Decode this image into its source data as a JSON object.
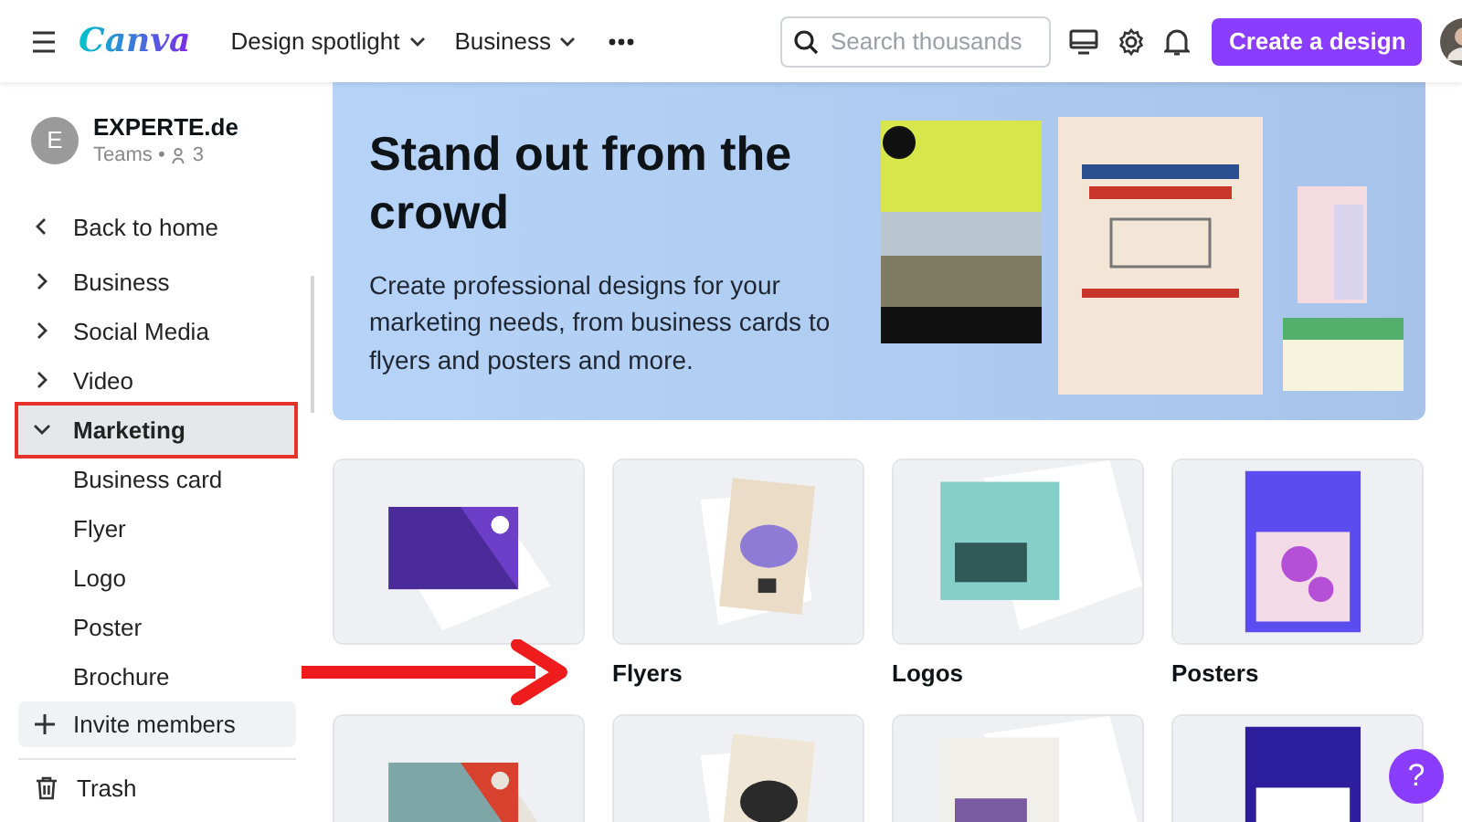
{
  "header": {
    "logo": "Canva",
    "nav": [
      {
        "label": "Design spotlight"
      },
      {
        "label": "Business"
      }
    ],
    "search": {
      "placeholder": "Search thousands"
    },
    "create_button": "Create a design"
  },
  "sidebar": {
    "team": {
      "initial": "E",
      "name": "EXPERTE.de",
      "plan": "Teams •",
      "members": "3"
    },
    "items": [
      {
        "kind": "back",
        "label": "Back to home",
        "selected": false
      },
      {
        "kind": "folder",
        "label": "Business",
        "expanded": false,
        "selected": false
      },
      {
        "kind": "folder",
        "label": "Social Media",
        "expanded": false,
        "selected": false
      },
      {
        "kind": "folder",
        "label": "Video",
        "expanded": false,
        "selected": false
      },
      {
        "kind": "folder",
        "label": "Marketing",
        "expanded": true,
        "selected": true,
        "highlighted": true,
        "children": [
          {
            "label": "Business card"
          },
          {
            "label": "Flyer"
          },
          {
            "label": "Logo"
          },
          {
            "label": "Poster"
          },
          {
            "label": "Brochure"
          }
        ]
      }
    ],
    "invite": "Invite members",
    "trash": "Trash"
  },
  "hero": {
    "title": "Stand out from the crowd",
    "text": "Create professional designs for your marketing needs, from business cards to flyers and posters and more.",
    "kind": "picture"
  },
  "cards": [
    {
      "kind": "picture"
    },
    {
      "kind": "picture",
      "label": "Flyers"
    },
    {
      "kind": "picture",
      "label": "Logos"
    },
    {
      "kind": "picture",
      "label": "Posters"
    },
    {
      "kind": "picture"
    },
    {
      "kind": "picture"
    },
    {
      "kind": "picture"
    },
    {
      "kind": "picture"
    }
  ],
  "annotation_arrow": true,
  "help_button": "?"
}
